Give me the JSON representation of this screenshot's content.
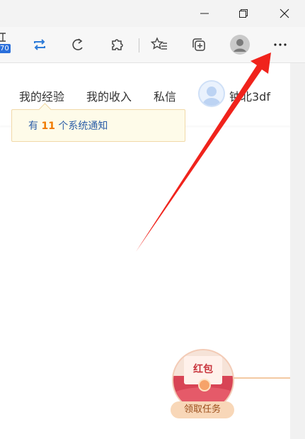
{
  "window": {
    "minimize_icon": "minimize-icon",
    "restore_icon": "restore-icon",
    "close_icon": "close-icon"
  },
  "toolbar": {
    "badge_text": "70",
    "icons": [
      "repeat-icon",
      "refresh-icon",
      "extensions-icon",
      "favorites-icon",
      "collections-icon",
      "profile-icon",
      "more-icon"
    ]
  },
  "nav": {
    "experience": "我的经验",
    "income": "我的收入",
    "messages": "私信",
    "username": "钟北3df"
  },
  "notice": {
    "prefix": "有",
    "count": "11",
    "suffix": "个系统通知"
  },
  "red_envelope": {
    "title": "红包",
    "action": "领取任务"
  },
  "colors": {
    "annotation_arrow": "#f0231c",
    "accent_blue": "#2d5fa8",
    "count_orange": "#f07a00"
  }
}
